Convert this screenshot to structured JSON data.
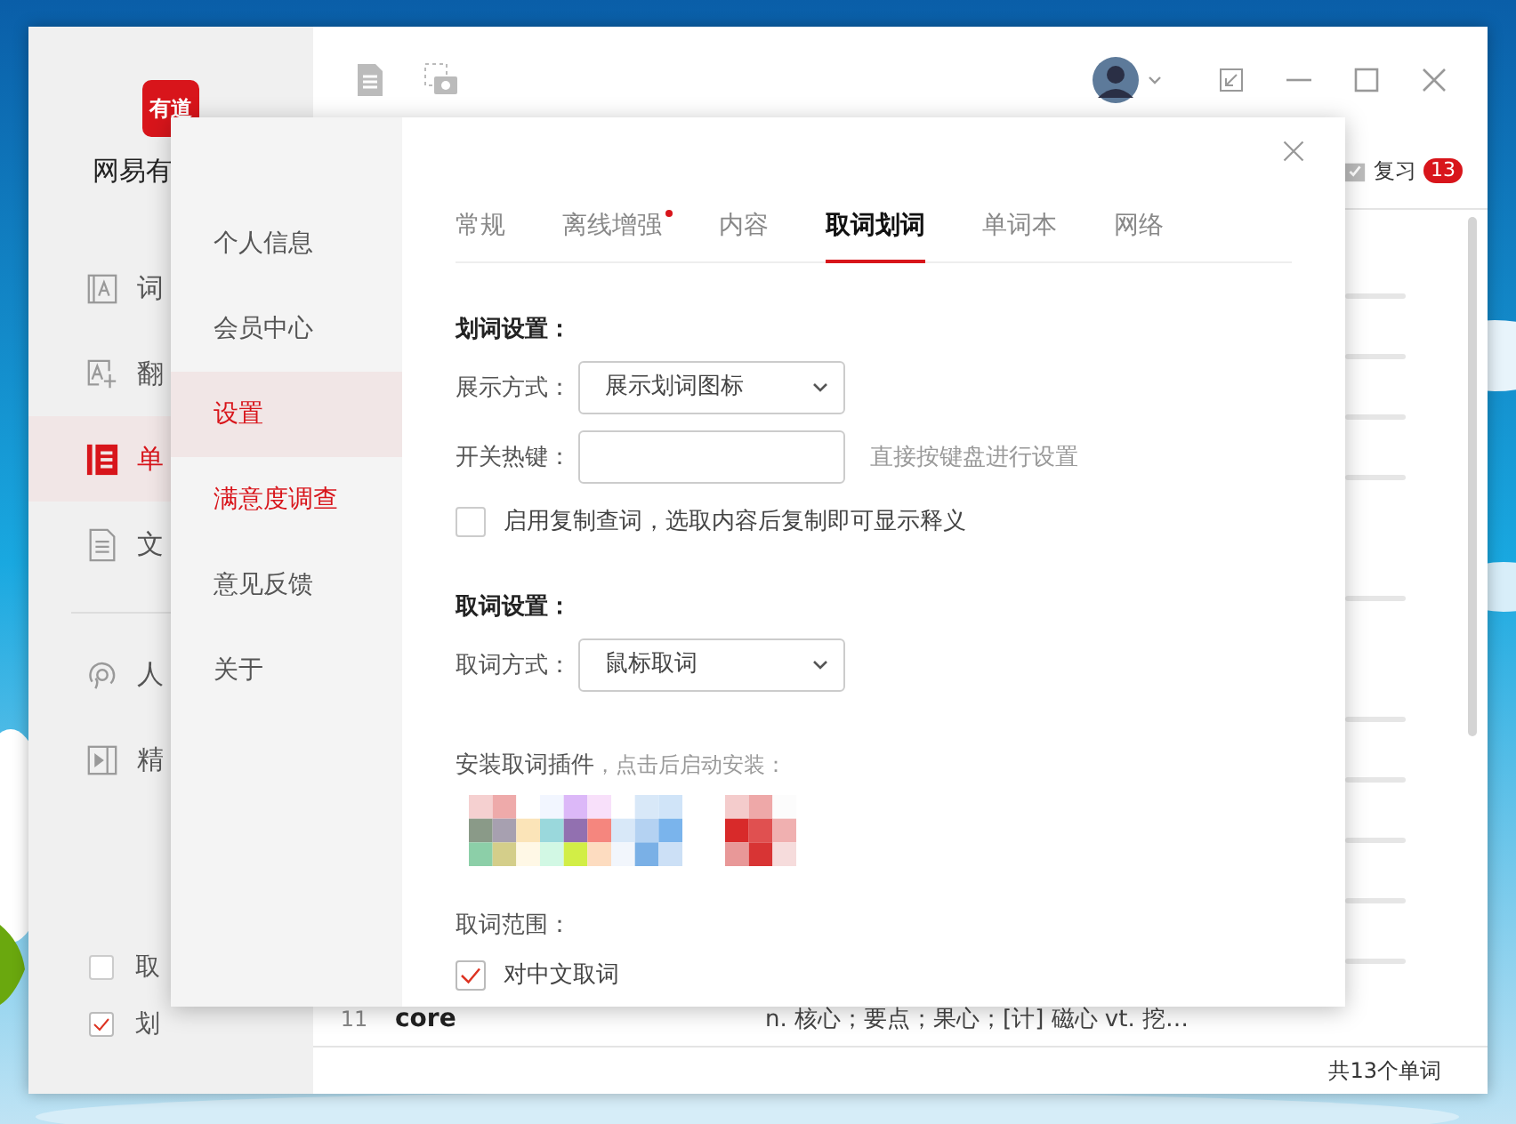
{
  "app": {
    "logo_text": "有道",
    "name": "网易有",
    "sidebar": [
      {
        "kind": "dict",
        "label": "词",
        "selected": false
      },
      {
        "kind": "translate",
        "label": "翻",
        "selected": false
      },
      {
        "kind": "wordbook",
        "label": "单",
        "selected": true
      },
      {
        "kind": "document",
        "label": "文",
        "selected": false
      },
      {
        "kind": "human",
        "label": "人",
        "selected": false
      },
      {
        "kind": "video",
        "label": "精",
        "selected": false
      }
    ],
    "options": [
      {
        "label": "取",
        "checked": false
      },
      {
        "label": "划",
        "checked": true
      }
    ]
  },
  "toolbar": {
    "review": {
      "label": "复习",
      "count": "13"
    }
  },
  "word_list": {
    "rows": [
      {
        "index": "11",
        "word": "core",
        "definition": "n. 核心；要点；果心；[计] 磁心  vt. 挖…"
      }
    ],
    "footer": "共13个单词"
  },
  "dialog": {
    "nav": [
      {
        "label": "个人信息",
        "selected": false,
        "highlight": false
      },
      {
        "label": "会员中心",
        "selected": false,
        "highlight": false
      },
      {
        "label": "设置",
        "selected": true,
        "highlight": false
      },
      {
        "label": "满意度调查",
        "selected": false,
        "highlight": true
      },
      {
        "label": "意见反馈",
        "selected": false,
        "highlight": false
      },
      {
        "label": "关于",
        "selected": false,
        "highlight": false
      }
    ],
    "tabs": [
      {
        "label": "常规",
        "selected": false,
        "dot": false
      },
      {
        "label": "离线增强",
        "selected": false,
        "dot": true
      },
      {
        "label": "内容",
        "selected": false,
        "dot": false
      },
      {
        "label": "取词划词",
        "selected": true,
        "dot": false
      },
      {
        "label": "单词本",
        "selected": false,
        "dot": false
      },
      {
        "label": "网络",
        "selected": false,
        "dot": false
      }
    ],
    "select_text": {
      "title": "划词设置：",
      "display_mode": {
        "label": "展示方式：",
        "value": "展示划词图标"
      },
      "hotkey": {
        "label": "开关热键：",
        "note": "直接按键盘进行设置"
      },
      "copy_lookup": {
        "label": "启用复制查词，选取内容后复制即可显示释义",
        "checked": false
      }
    },
    "pick_word": {
      "title": "取词设置：",
      "mode": {
        "label": "取词方式：",
        "value": "鼠标取词"
      },
      "plugins": {
        "label": "安装取词插件",
        "hint": "，点击后启动安装："
      },
      "scope": {
        "label": "取词范围：",
        "options": [
          {
            "label": "对中文取词",
            "checked": true
          }
        ]
      }
    }
  }
}
